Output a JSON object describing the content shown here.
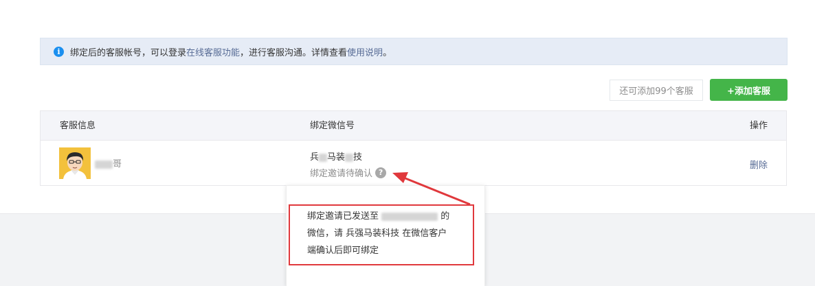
{
  "notice": {
    "icon": "info-icon",
    "text_before": "绑定后的客服帐号，可以登录",
    "link1": "在线客服功能",
    "text_middle": "，进行客服沟通。详情查看",
    "link2": "使用说明",
    "text_after": "。"
  },
  "toolbar": {
    "quota_text": "还可添加99个客服",
    "add_button_label": "+添加客服"
  },
  "table": {
    "headers": {
      "info": "客服信息",
      "wechat": "绑定微信号",
      "action": "操作"
    },
    "rows": [
      {
        "avatar": "avatar-image",
        "name_suffix": "哥",
        "wechat_prefix": "兵",
        "wechat_middle": "马装",
        "wechat_suffix": "技",
        "status": "绑定邀请待确认",
        "status_icon": "question-icon",
        "action": "删除"
      }
    ]
  },
  "popover": {
    "line1_before": "绑定邀请已发送至",
    "line1_after": "的",
    "line2": "微信，请 兵强马装科技 在微信客户",
    "line3": "端确认后即可绑定"
  },
  "colors": {
    "accent_green": "#44b549",
    "link_blue": "#576b95",
    "annotation_red": "#e0383c",
    "info_blue": "#1b8fef"
  }
}
